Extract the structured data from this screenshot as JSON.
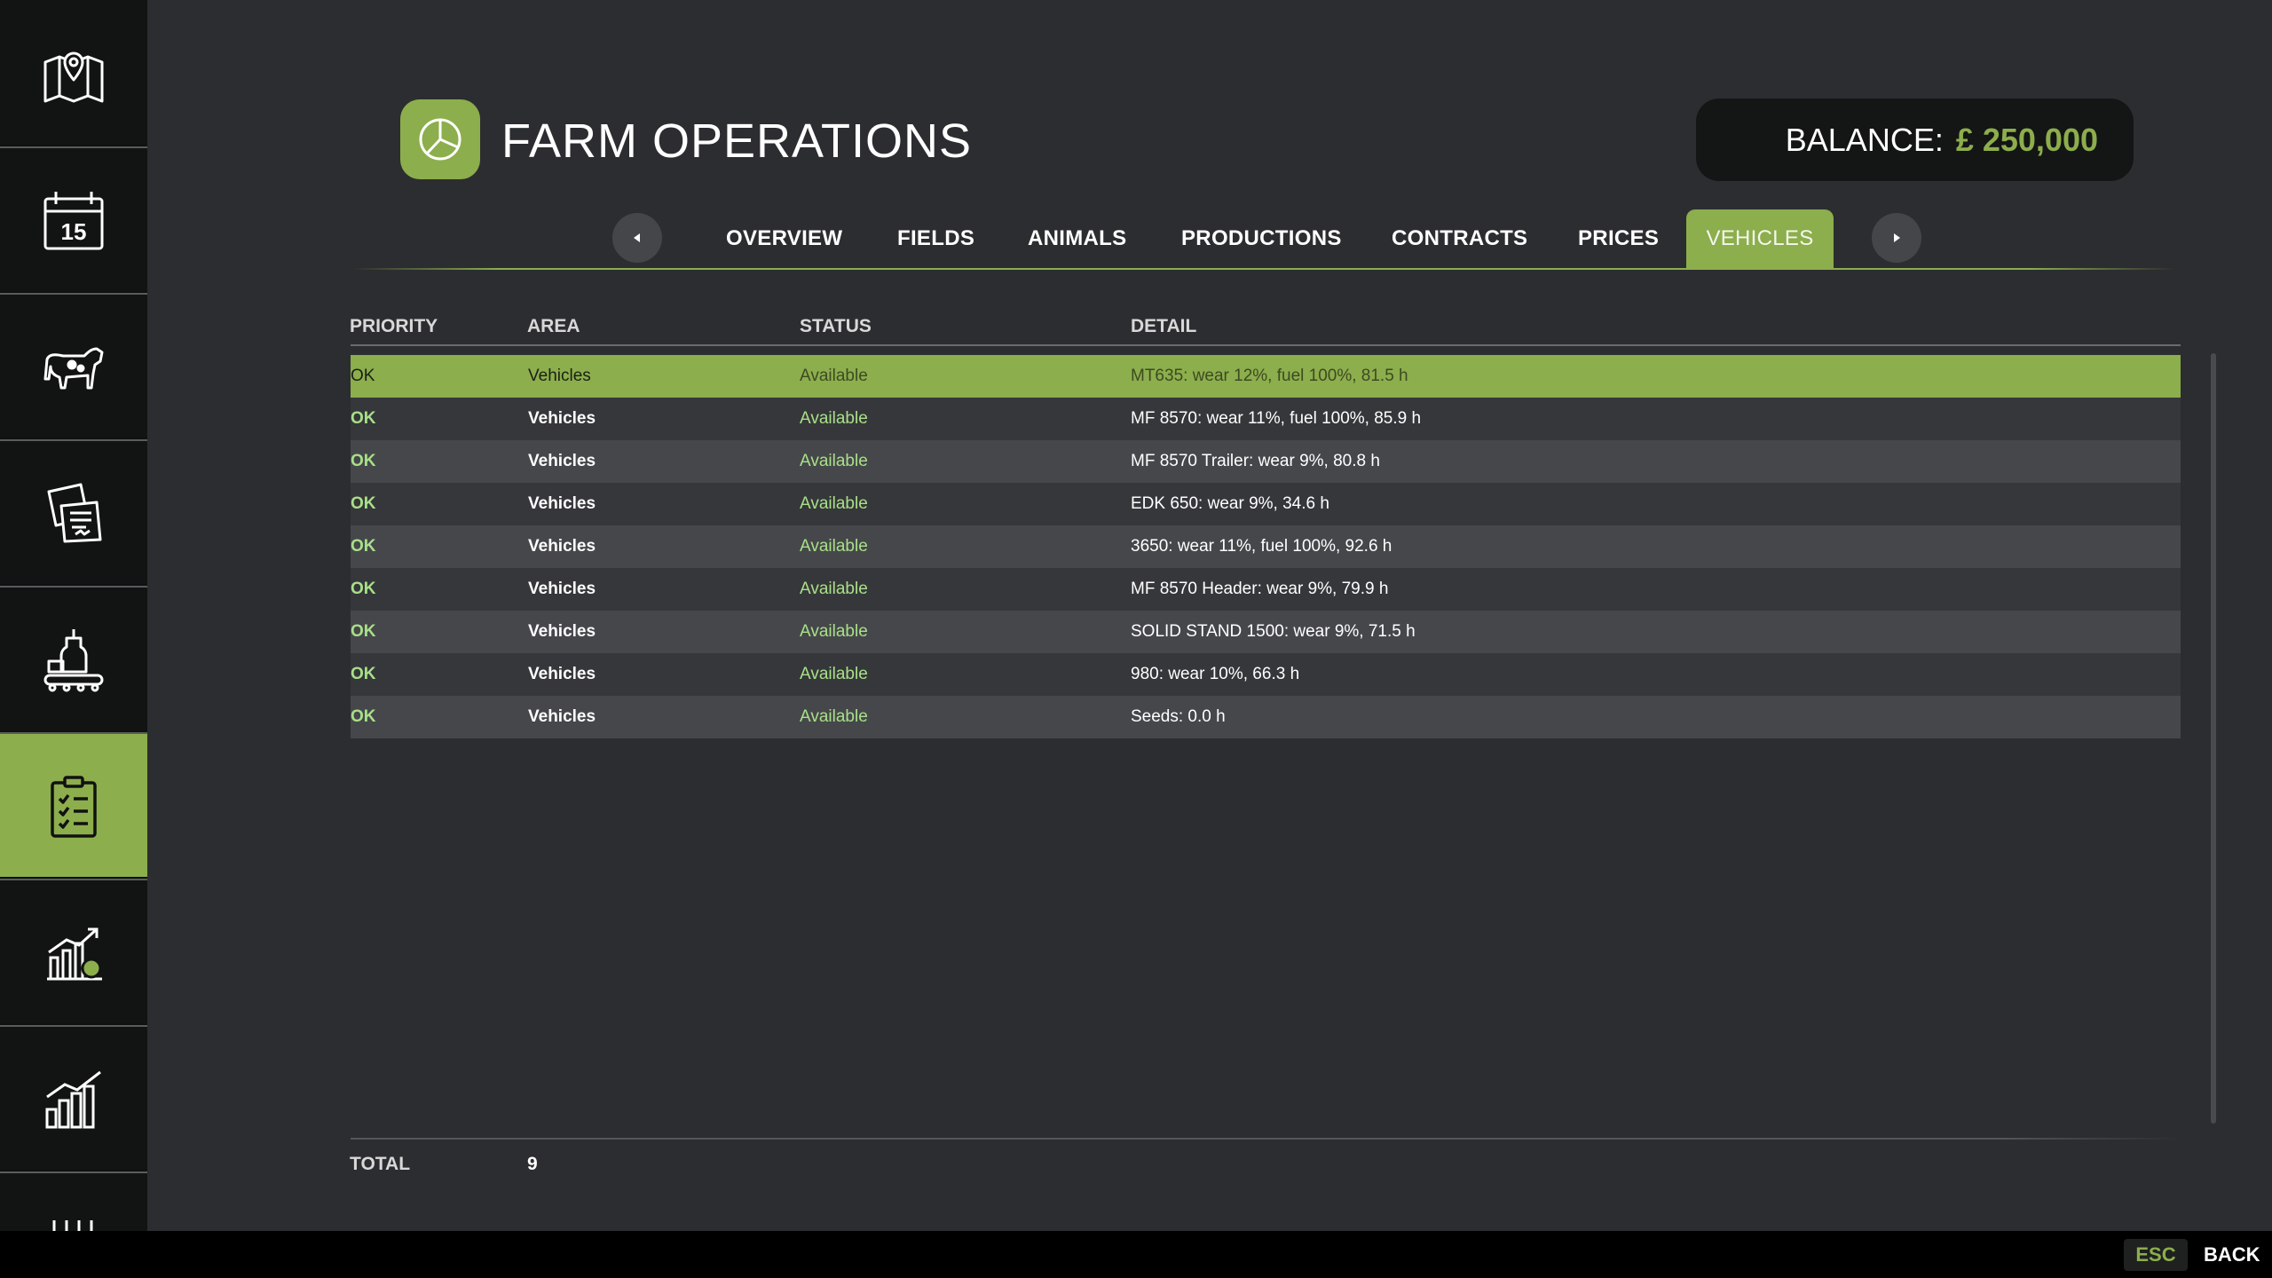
{
  "header": {
    "title": "FARM OPERATIONS",
    "balance_label": "BALANCE:",
    "balance_value": "£ 250,000"
  },
  "sidebar": {
    "items": [
      {
        "icon": "map-icon"
      },
      {
        "icon": "calendar-icon",
        "text": "15"
      },
      {
        "icon": "cow-icon"
      },
      {
        "icon": "documents-icon"
      },
      {
        "icon": "production-icon"
      },
      {
        "icon": "clipboard-checklist-icon",
        "active": true
      },
      {
        "icon": "finance-chart-icon"
      },
      {
        "icon": "statistics-chart-icon"
      },
      {
        "icon": "settings-icon"
      }
    ]
  },
  "tabs": [
    {
      "label": "OVERVIEW"
    },
    {
      "label": "FIELDS"
    },
    {
      "label": "ANIMALS"
    },
    {
      "label": "PRODUCTIONS"
    },
    {
      "label": "CONTRACTS"
    },
    {
      "label": "PRICES"
    },
    {
      "label": "VEHICLES",
      "active": true
    }
  ],
  "table": {
    "columns": [
      "PRIORITY",
      "AREA",
      "STATUS",
      "DETAIL"
    ],
    "rows": [
      {
        "priority": "OK",
        "area": "Vehicles",
        "status": "Available",
        "detail": "MT635: wear 12%, fuel 100%, 81.5 h",
        "selected": true
      },
      {
        "priority": "OK",
        "area": "Vehicles",
        "status": "Available",
        "detail": "MF 8570: wear 11%, fuel 100%, 85.9 h"
      },
      {
        "priority": "OK",
        "area": "Vehicles",
        "status": "Available",
        "detail": "MF 8570 Trailer: wear 9%, 80.8 h"
      },
      {
        "priority": "OK",
        "area": "Vehicles",
        "status": "Available",
        "detail": "EDK 650: wear 9%, 34.6 h"
      },
      {
        "priority": "OK",
        "area": "Vehicles",
        "status": "Available",
        "detail": "3650: wear 11%, fuel 100%, 92.6 h"
      },
      {
        "priority": "OK",
        "area": "Vehicles",
        "status": "Available",
        "detail": "MF 8570 Header: wear 9%, 79.9 h"
      },
      {
        "priority": "OK",
        "area": "Vehicles",
        "status": "Available",
        "detail": "SOLID STAND 1500: wear 9%, 71.5 h"
      },
      {
        "priority": "OK",
        "area": "Vehicles",
        "status": "Available",
        "detail": "980: wear 10%, 66.3 h"
      },
      {
        "priority": "OK",
        "area": "Vehicles",
        "status": "Available",
        "detail": "Seeds: 0.0 h"
      }
    ],
    "total_label": "TOTAL",
    "total_value": "9"
  },
  "footer": {
    "esc_key": "ESC",
    "back_label": "BACK"
  },
  "colors": {
    "accent": "#8cae4c",
    "status_ok": "#a8e088",
    "background": "#2c2d30",
    "sidebar": "#121313"
  }
}
